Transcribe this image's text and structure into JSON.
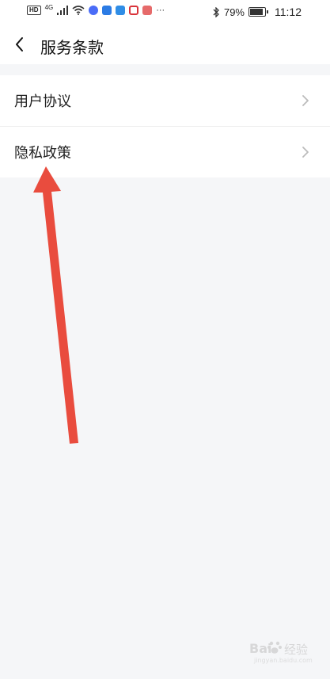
{
  "status_bar": {
    "hd_badge": "HD",
    "network": "4G",
    "battery": "79%",
    "time": "11:12",
    "overflow": "···",
    "battery_fill_fraction": 0.79,
    "app_icon_colors": [
      "#4a6cf7",
      "#2b7be4",
      "#2f8de6",
      "#d9333a",
      "#e04545"
    ]
  },
  "navbar": {
    "title": "服务条款",
    "back_icon": "chevron-left-icon"
  },
  "list": {
    "items": [
      {
        "label": "用户协议",
        "icon": "chevron-right-icon"
      },
      {
        "label": "隐私政策",
        "icon": "chevron-right-icon"
      }
    ]
  },
  "watermark": {
    "brand": "Bai",
    "brand_suffix": "经验",
    "sub": "jingyan.baidu.com"
  },
  "colors": {
    "page_bg": "#f5f6f8",
    "card_bg": "#ffffff",
    "chevron": "#bbbbbb",
    "annotation_arrow": "#e84234"
  }
}
